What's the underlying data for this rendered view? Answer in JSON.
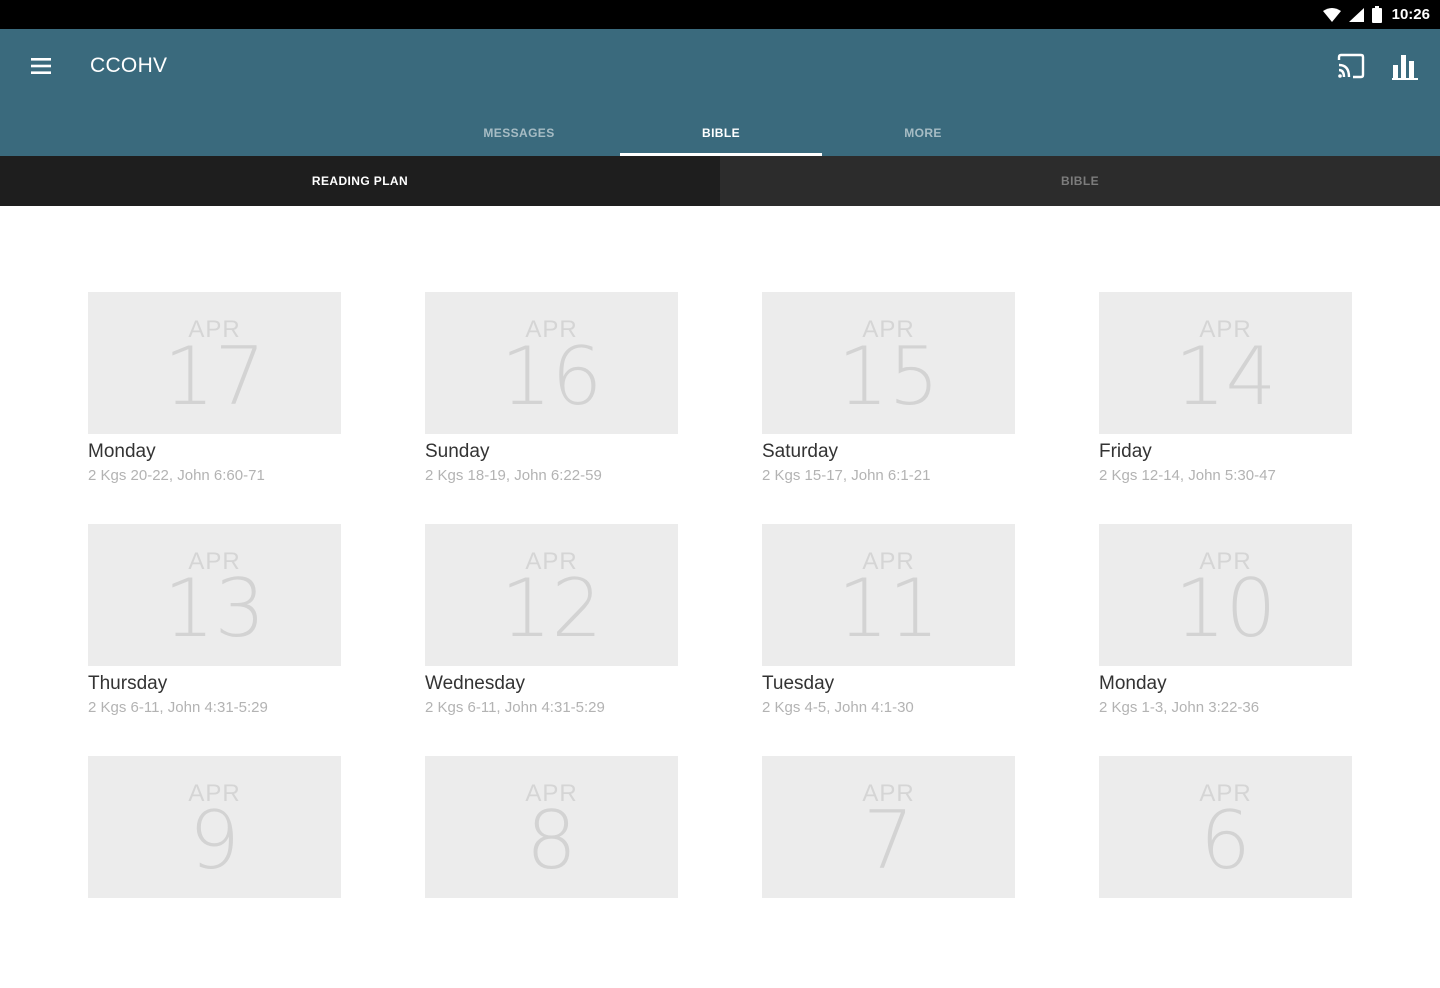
{
  "status_bar": {
    "time": "10:26"
  },
  "app_bar": {
    "title": "CCOHV",
    "tabs": [
      {
        "label": "MESSAGES",
        "active": false
      },
      {
        "label": "BIBLE",
        "active": true
      },
      {
        "label": "MORE",
        "active": false
      }
    ]
  },
  "sub_tabs": [
    {
      "label": "READING PLAN",
      "active": true
    },
    {
      "label": "BIBLE",
      "active": false
    }
  ],
  "reading_days": [
    {
      "month": "APR",
      "day": "17",
      "weekday": "Monday",
      "reading": "2 Kgs 20-22, John 6:60-71"
    },
    {
      "month": "APR",
      "day": "16",
      "weekday": "Sunday",
      "reading": "2 Kgs 18-19, John 6:22-59"
    },
    {
      "month": "APR",
      "day": "15",
      "weekday": "Saturday",
      "reading": "2 Kgs 15-17, John 6:1-21"
    },
    {
      "month": "APR",
      "day": "14",
      "weekday": "Friday",
      "reading": "2 Kgs 12-14, John 5:30-47"
    },
    {
      "month": "APR",
      "day": "13",
      "weekday": "Thursday",
      "reading": "2 Kgs 6-11, John 4:31-5:29"
    },
    {
      "month": "APR",
      "day": "12",
      "weekday": "Wednesday",
      "reading": "2 Kgs 6-11, John 4:31-5:29"
    },
    {
      "month": "APR",
      "day": "11",
      "weekday": "Tuesday",
      "reading": "2 Kgs 4-5, John 4:1-30"
    },
    {
      "month": "APR",
      "day": "10",
      "weekday": "Monday",
      "reading": "2 Kgs 1-3, John 3:22-36"
    },
    {
      "month": "APR",
      "day": "9",
      "weekday": "",
      "reading": ""
    },
    {
      "month": "APR",
      "day": "8",
      "weekday": "",
      "reading": ""
    },
    {
      "month": "APR",
      "day": "7",
      "weekday": "",
      "reading": ""
    },
    {
      "month": "APR",
      "day": "6",
      "weekday": "",
      "reading": ""
    }
  ],
  "colors": {
    "app_bar": "#3a6a7d",
    "sub_tab_active": "#1e1e1e",
    "sub_tab_inactive": "#2c2c2c",
    "tile": "#ececec"
  },
  "icons": [
    "wifi-icon",
    "cell-signal-icon",
    "battery-icon",
    "menu-icon",
    "cast-icon",
    "bar-chart-icon"
  ]
}
